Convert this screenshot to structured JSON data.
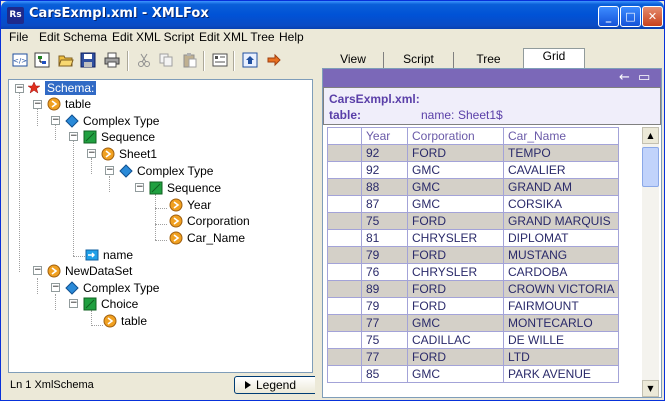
{
  "window": {
    "title": "CarsExmpl.xml - XMLFox",
    "app_icon_text": "Rs"
  },
  "menu": [
    "File",
    "Edit Schema",
    "Edit XML Script",
    "Edit XML Tree",
    "Help"
  ],
  "toolbar": {
    "icons": [
      "view-source-icon",
      "schema-icon",
      "open-folder-icon",
      "save-icon",
      "print-icon",
      "cut-icon",
      "copy-icon",
      "paste-icon",
      "properties-icon",
      "export-icon",
      "next-arrow-icon"
    ]
  },
  "tree": {
    "nodes": [
      {
        "label": "Schema:",
        "icon": "star-icon",
        "selected": true
      },
      {
        "label": "table",
        "icon": "element-icon"
      },
      {
        "label": "Complex Type",
        "icon": "complex-type-icon"
      },
      {
        "label": "Sequence",
        "icon": "sequence-icon"
      },
      {
        "label": "Sheet1",
        "icon": "element-icon"
      },
      {
        "label": "Complex Type",
        "icon": "complex-type-icon"
      },
      {
        "label": "Sequence",
        "icon": "sequence-icon"
      },
      {
        "label": "Year",
        "icon": "element-icon"
      },
      {
        "label": "Corporation",
        "icon": "element-icon"
      },
      {
        "label": "Car_Name",
        "icon": "element-icon"
      },
      {
        "label": "name",
        "icon": "attribute-icon"
      },
      {
        "label": "NewDataSet",
        "icon": "element-icon"
      },
      {
        "label": "Complex Type",
        "icon": "complex-type-icon"
      },
      {
        "label": "Choice",
        "icon": "choice-icon"
      },
      {
        "label": "table",
        "icon": "element-icon"
      }
    ]
  },
  "status": {
    "text": "Ln 1  XmlSchema",
    "legend_label": "Legend"
  },
  "tabs": [
    {
      "label": "View",
      "active": false
    },
    {
      "label": "Script",
      "active": false
    },
    {
      "label": "Tree",
      "active": false
    },
    {
      "label": "Grid",
      "active": true
    }
  ],
  "grid": {
    "file_label": "CarsExmpl.xml:",
    "table_label": "table:",
    "name_label": "name:",
    "name_value": "Sheet1$",
    "columns": [
      "Year",
      "Corporation",
      "Car_Name"
    ],
    "rows": [
      [
        "92",
        "FORD",
        "TEMPO"
      ],
      [
        "92",
        "GMC",
        "CAVALIER"
      ],
      [
        "88",
        "GMC",
        "GRAND AM"
      ],
      [
        "87",
        "GMC",
        "CORSIKA"
      ],
      [
        "75",
        "FORD",
        "GRAND MARQUIS"
      ],
      [
        "81",
        "CHRYSLER",
        "DIPLOMAT"
      ],
      [
        "79",
        "FORD",
        "MUSTANG"
      ],
      [
        "76",
        "CHRYSLER",
        "CARDOBA"
      ],
      [
        "89",
        "FORD",
        "CROWN VICTORIA"
      ],
      [
        "79",
        "FORD",
        "FAIRMOUNT"
      ],
      [
        "77",
        "GMC",
        "MONTECARLO"
      ],
      [
        "75",
        "CADILLAC",
        "DE WILLE"
      ],
      [
        "77",
        "FORD",
        "LTD"
      ],
      [
        "85",
        "GMC",
        "PARK AVENUE"
      ]
    ]
  },
  "colors": {
    "titlebar": "#0052d6",
    "selection": "#316ac5",
    "grid_header": "#7b68b8",
    "grid_text": "#2a2a6a",
    "row_shade": "#d4d0c8"
  }
}
